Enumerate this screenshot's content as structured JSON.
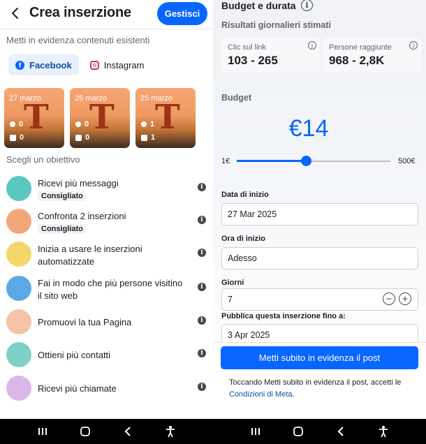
{
  "left": {
    "title": "Crea inserzione",
    "manage_label": "Gestisci",
    "subtitle": "Metti in evidenza contenuti esistenti",
    "tabs": [
      {
        "label": "Facebook",
        "icon": "facebook-icon"
      },
      {
        "label": "Instagram",
        "icon": "instagram-icon"
      }
    ],
    "posts": [
      {
        "date": "27 marzo",
        "letter": "T",
        "comments": "0",
        "likes": "0"
      },
      {
        "date": "25 marzo",
        "letter": "T",
        "comments": "0",
        "likes": "0"
      },
      {
        "date": "25 marzo",
        "letter": "T",
        "comments": "1",
        "likes": "1"
      }
    ],
    "objectives_label": "Scegli un obiettivo",
    "objectives": [
      {
        "label": "Ricevi più messaggi",
        "badge": "Consigliato",
        "icon": "message-icon",
        "color": "#5ac8c0"
      },
      {
        "label": "Confronta 2 inserzioni",
        "badge": "Consigliato",
        "icon": "compare-icon",
        "color": "#f2a77a"
      },
      {
        "label": "Inizia a usare le inserzioni automatizzate",
        "badge": "",
        "icon": "magic-wand-icon",
        "color": "#f5d66a"
      },
      {
        "label": "Fai in modo che più persone visitino il sito web",
        "badge": "",
        "icon": "cursor-icon",
        "color": "#5aa9e6"
      },
      {
        "label": "Promuovi la tua Pagina",
        "badge": "",
        "icon": "flag-icon",
        "color": "#f5c3a8"
      },
      {
        "label": "Ottieni più contatti",
        "badge": "",
        "icon": "contact-card-icon",
        "color": "#7fd0c4"
      },
      {
        "label": "Ricevi più chiamate",
        "badge": "",
        "icon": "phone-icon",
        "color": "#d9b7e8"
      }
    ]
  },
  "right": {
    "title": "Budget e durata",
    "estimates_label": "Risultati giornalieri stimati",
    "metrics": [
      {
        "label": "Clic sul link",
        "value": "103 - 265"
      },
      {
        "label": "Persone raggiunte",
        "value": "968 - 2,8K"
      }
    ],
    "budget_label": "Budget",
    "budget_value": "€14",
    "slider_min": "1€",
    "slider_max": "500€",
    "slider_fraction": 0.45,
    "start_date_label": "Data di inizio",
    "start_date": "27 Mar 2025",
    "start_time_label": "Ora di inizio",
    "start_time": "Adesso",
    "days_label": "Giorni",
    "days": "7",
    "end_label": "Pubblica questa inserzione fino a:",
    "end_date": "3 Apr 2025",
    "cta_label": "Metti subito in evidenza il post",
    "legal_text": "Toccando Metti subito in evidenza il post, accetti le",
    "legal_link": "Condizioni di Meta",
    "legal_end": "."
  },
  "colors": {
    "accent": "#0866ff",
    "nav_bg": "#000000"
  }
}
